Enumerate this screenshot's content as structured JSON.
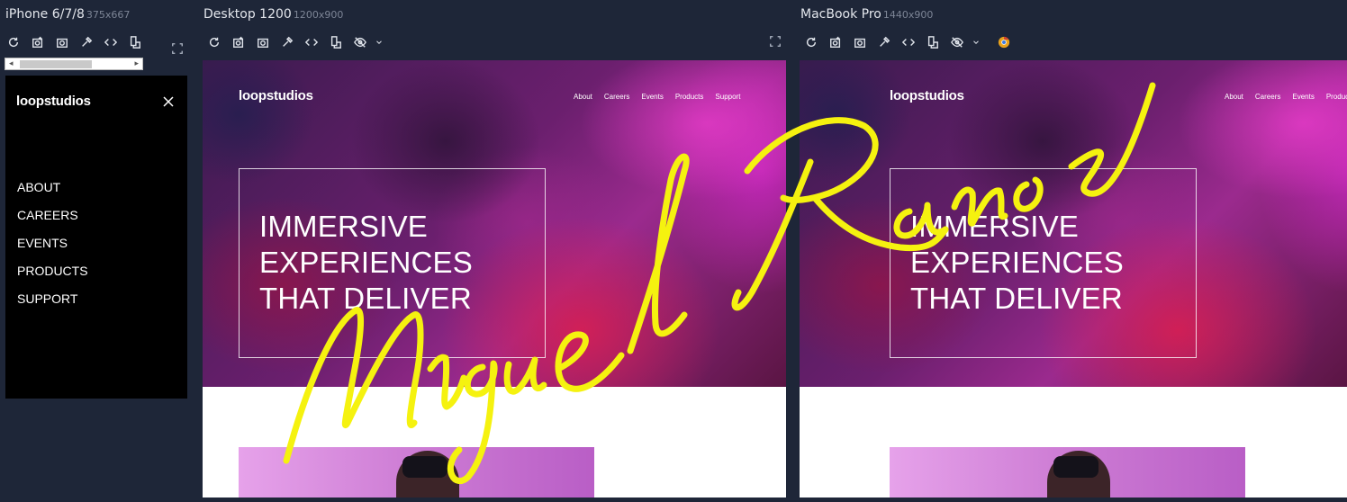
{
  "panes": [
    {
      "name": "iPhone 6/7/8",
      "size": "375x667"
    },
    {
      "name": "Desktop 1200",
      "size": "1200x900"
    },
    {
      "name": "MacBook Pro",
      "size": "1440x900"
    }
  ],
  "toolbar_icons": [
    "refresh-icon",
    "screenshot-full-icon",
    "camera-icon",
    "eyedropper-icon",
    "code-icon",
    "rotate-icon",
    "eye-off-icon",
    "chevron-down-icon",
    "chrome-icon",
    "fullscreen-icon"
  ],
  "site": {
    "logo": "loopstudios",
    "nav": [
      "About",
      "Careers",
      "Events",
      "Products",
      "Support"
    ],
    "headline": [
      "IMMERSIVE",
      "EXPERIENCES",
      "THAT DELIVER"
    ]
  },
  "mobile_menu": {
    "logo": "loopstudios",
    "close_icon": "close-icon",
    "items": [
      "ABOUT",
      "CAREERS",
      "EVENTS",
      "PRODUCTS",
      "SUPPORT"
    ]
  },
  "watermark": {
    "text": "Miguel Ramos",
    "color": "#f5f20f"
  },
  "colors": {
    "frame_bg": "#1e2638",
    "hero_magenta": "#9b2a8e",
    "white": "#ffffff"
  }
}
